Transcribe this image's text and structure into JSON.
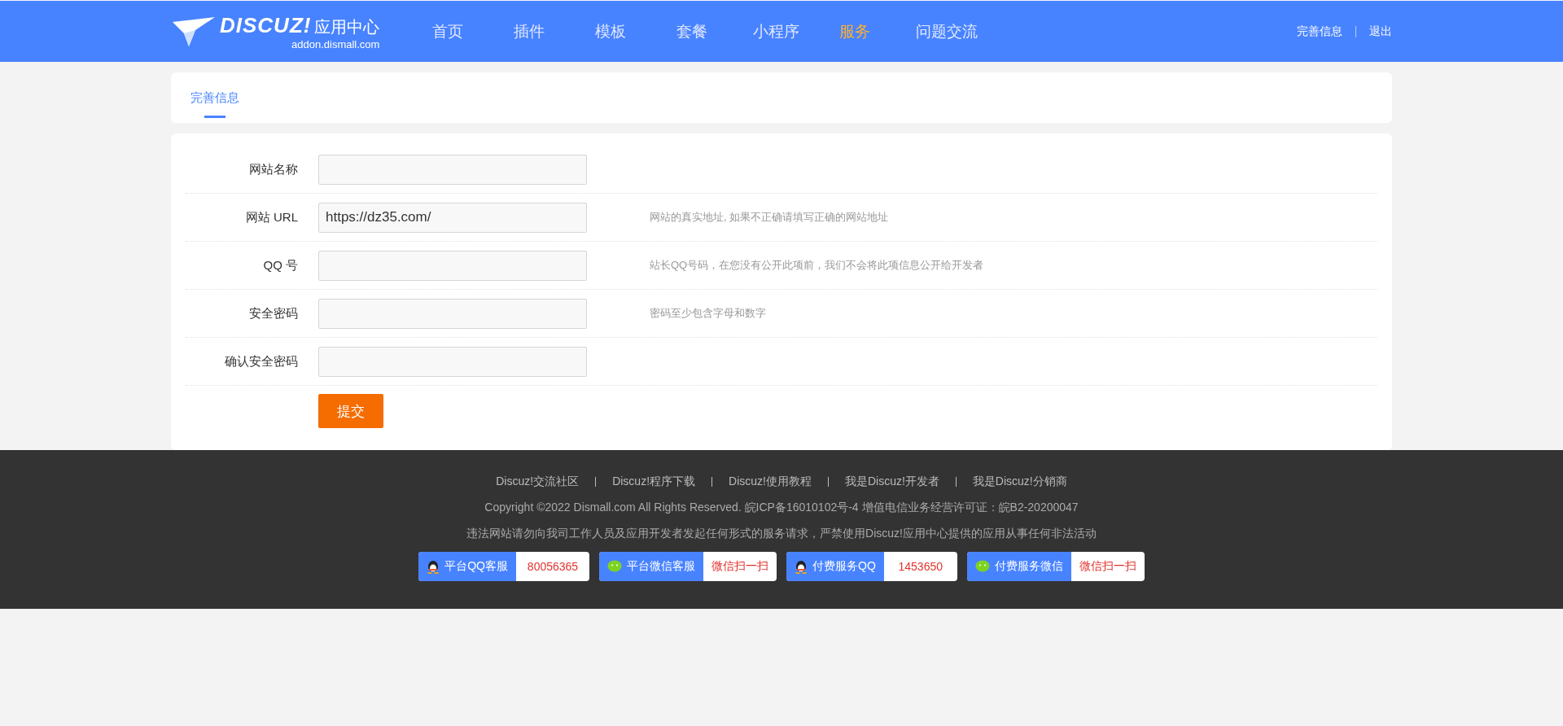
{
  "header": {
    "logo": {
      "brand": "DISCUZ!",
      "title": "应用中心",
      "subtitle": "addon.dismall.com"
    },
    "nav": [
      {
        "label": "首页",
        "selected": false
      },
      {
        "label": "插件",
        "selected": false
      },
      {
        "label": "模板",
        "selected": false
      },
      {
        "label": "套餐",
        "selected": false
      },
      {
        "label": "小程序",
        "selected": false
      },
      {
        "label": "服务",
        "selected": true
      },
      {
        "label": "问题交流",
        "selected": false
      }
    ],
    "user_links": [
      "完善信息",
      "退出"
    ]
  },
  "tabs": [
    {
      "label": "完善信息",
      "selected": true
    }
  ],
  "form": {
    "fields": [
      {
        "label": "网站名称"
      },
      {
        "label": "网站 URL",
        "value": "https://dz35.com/",
        "hint": "网站的真实地址, 如果不正确请填写正确的网站地址"
      },
      {
        "label": "QQ 号",
        "hint": "站长QQ号码，在您没有公开此项前，我们不会将此项信息公开给开发者"
      },
      {
        "label": "安全密码",
        "hint": "密码至少包含字母和数字"
      },
      {
        "label": "确认安全密码"
      }
    ],
    "submit": "提交"
  },
  "footer": {
    "links": [
      "Discuz!交流社区",
      "Discuz!程序下载",
      "Discuz!使用教程",
      "我是Discuz!开发者",
      "我是Discuz!分销商"
    ],
    "copyright": "Copyright ©2022  Dismall.com  All Rights Reserved.  皖ICP备16010102号-4   增值电信业务经营许可证：皖B2-20200047",
    "notice": "违法网站请勿向我司工作人员及应用开发者发起任何形式的服务请求，严禁使用Discuz!应用中心提供的应用从事任何非法活动",
    "contacts": [
      {
        "kind": "qq",
        "label": "平台QQ客服",
        "value": "80056365"
      },
      {
        "kind": "wechat",
        "label": "平台微信客服",
        "value": "微信扫一扫"
      },
      {
        "kind": "qq",
        "label": "付费服务QQ",
        "value": "1453650"
      },
      {
        "kind": "wechat",
        "label": "付费服务微信",
        "value": "微信扫一扫"
      }
    ]
  }
}
